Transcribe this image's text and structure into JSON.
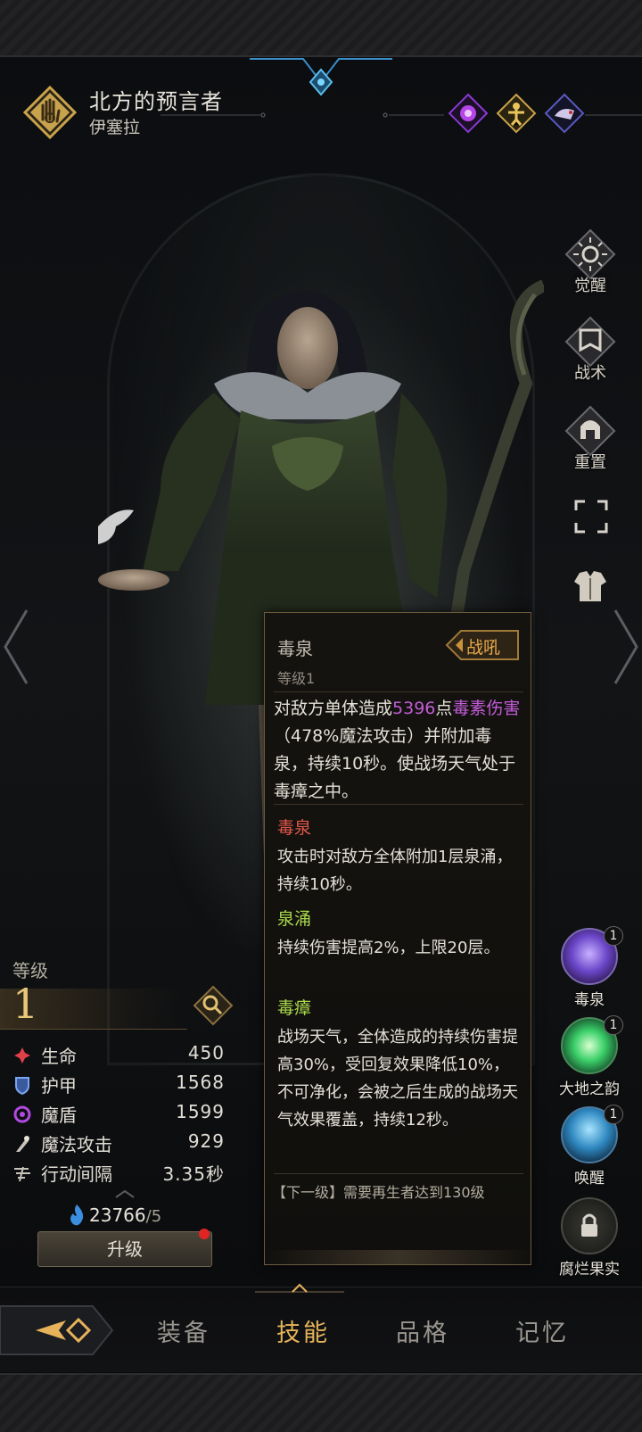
{
  "hero": {
    "title": "北方的预言者",
    "name": "伊塞拉",
    "traits": [
      "purple-rune-icon",
      "gold-figure-icon",
      "beast-icon"
    ]
  },
  "side_menu": [
    {
      "label": "觉醒",
      "icon": "sun-emblem-icon"
    },
    {
      "label": "战术",
      "icon": "banner-icon"
    },
    {
      "label": "重置",
      "icon": "helmet-icon"
    },
    {
      "label": "",
      "icon": "fullscreen-icon"
    },
    {
      "label": "",
      "icon": "armor-icon"
    }
  ],
  "skill_panel": {
    "name": "毒泉",
    "level": "等级1",
    "tag": "战吼",
    "desc_pre": "对敌方单体造成",
    "desc_value": "5396",
    "desc_mid": "点",
    "desc_type": "毒素伤害",
    "desc_post": "（478%魔法攻击）并附加毒泉，持续10秒。使战场天气处于毒瘴之中。",
    "subs": [
      {
        "title": "毒泉",
        "text": "攻击时对敌方全体附加1层泉涌，持续10秒。"
      },
      {
        "title": "泉涌",
        "text": "持续伤害提高2%，上限20层。"
      },
      {
        "title": "毒瘴",
        "text": "战场天气，全体造成的持续伤害提高30%，受回复效果降低10%，不可净化，会被之后生成的战场天气效果覆盖，持续12秒。"
      }
    ],
    "next_level": "【下一级】需要再生者达到130级"
  },
  "skills": [
    {
      "name": "毒泉",
      "badge": "1",
      "color": "#7b5ad8"
    },
    {
      "name": "大地之韵",
      "badge": "1",
      "color": "#3ccf6a"
    },
    {
      "name": "唤醒",
      "badge": "1",
      "color": "#3f9ad0"
    },
    {
      "name": "腐烂果实",
      "badge": "",
      "color": "#3a3a3a"
    }
  ],
  "stats": {
    "level_label": "等级",
    "level": "1",
    "rows": [
      {
        "key": "生命",
        "value": "450",
        "icon": "health-icon",
        "color": "#e0404a"
      },
      {
        "key": "护甲",
        "value": "1568",
        "icon": "shield-icon",
        "color": "#5a8de0"
      },
      {
        "key": "魔盾",
        "value": "1599",
        "icon": "magic-shield-icon",
        "color": "#b04ae0"
      },
      {
        "key": "魔法攻击",
        "value": "929",
        "icon": "magic-attack-icon",
        "color": "#c8c4bc"
      },
      {
        "key": "行动间隔",
        "value": "3.35秒",
        "icon": "speed-icon",
        "color": "#c8c4bc"
      }
    ],
    "soul": "23766",
    "soul_max": "/5",
    "upgrade": "升级"
  },
  "tabs": [
    {
      "label": "装备",
      "active": false
    },
    {
      "label": "技能",
      "active": true
    },
    {
      "label": "品格",
      "active": false
    },
    {
      "label": "记忆",
      "active": false
    }
  ]
}
